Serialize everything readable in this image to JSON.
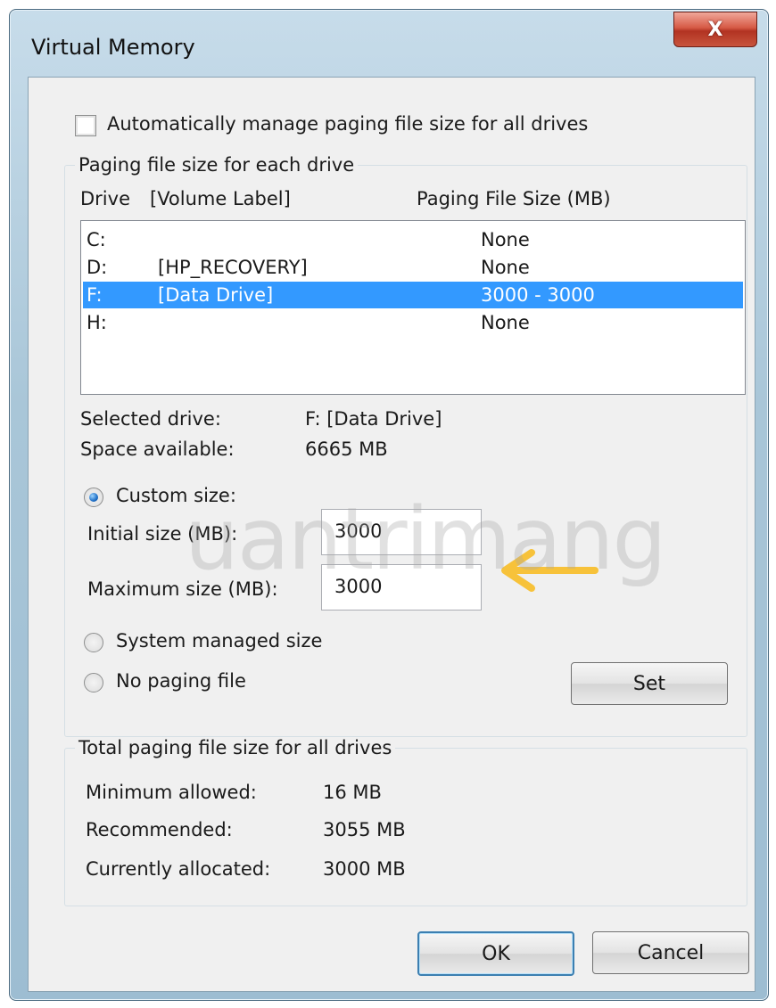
{
  "window": {
    "title": "Virtual Memory",
    "close_label": "X"
  },
  "auto_manage": {
    "label": "Automatically manage paging file size for all drives",
    "checked": false
  },
  "per_drive": {
    "legend": "Paging file size for each drive",
    "col_drive": "Drive",
    "col_label": "[Volume Label]",
    "col_size": "Paging File Size (MB)",
    "rows": [
      {
        "drive": "C:",
        "label": "",
        "size": "None",
        "selected": false
      },
      {
        "drive": "D:",
        "label": "[HP_RECOVERY]",
        "size": "None",
        "selected": false
      },
      {
        "drive": "F:",
        "label": "[Data Drive]",
        "size": "3000 - 3000",
        "selected": true
      },
      {
        "drive": "H:",
        "label": "",
        "size": "None",
        "selected": false
      }
    ],
    "selected_drive_label": "Selected drive:",
    "selected_drive_value": "F:  [Data Drive]",
    "space_label": "Space available:",
    "space_value": "6665 MB",
    "custom_size_label": "Custom size:",
    "initial_label": "Initial size (MB):",
    "initial_value": "3000",
    "max_label": "Maximum size (MB):",
    "max_value": "3000",
    "system_managed_label": "System managed size",
    "no_paging_label": "No paging file",
    "set_label": "Set"
  },
  "totals": {
    "legend": "Total paging file size for all drives",
    "min_label": "Minimum allowed:",
    "min_value": "16 MB",
    "rec_label": "Recommended:",
    "rec_value": "3055 MB",
    "cur_label": "Currently allocated:",
    "cur_value": "3000 MB"
  },
  "buttons": {
    "ok_label": "OK",
    "cancel_label": "Cancel"
  },
  "watermark": "uantrimang",
  "colors": {
    "selection": "#3399ff",
    "arrow": "#f7c23a",
    "close": "#c8463a"
  }
}
